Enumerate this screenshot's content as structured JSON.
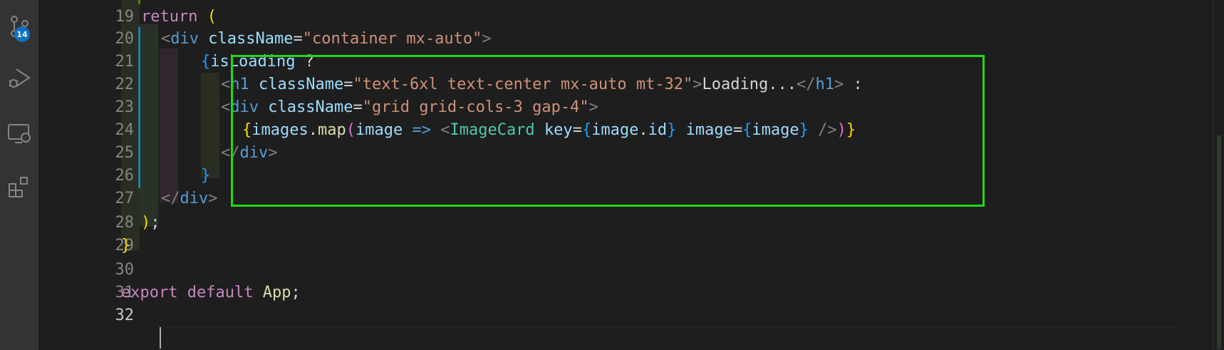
{
  "activity_bar": {
    "items": [
      {
        "icon": "source-control-icon",
        "badge": "14"
      },
      {
        "icon": "run-debug-icon"
      },
      {
        "icon": "remote-explorer-icon"
      },
      {
        "icon": "extensions-icon"
      }
    ]
  },
  "editor": {
    "language": "jsx",
    "lines": [
      {
        "number": "19"
      },
      {
        "number": "20"
      },
      {
        "number": "21"
      },
      {
        "number": "22"
      },
      {
        "number": "23"
      },
      {
        "number": "24"
      },
      {
        "number": "25"
      },
      {
        "number": "26"
      },
      {
        "number": "27"
      },
      {
        "number": "28"
      },
      {
        "number": "29"
      },
      {
        "number": "30"
      },
      {
        "number": "31"
      },
      {
        "number": "32"
      }
    ],
    "tokens": {
      "l19": [
        "return",
        "("
      ],
      "l20": [
        "<",
        "div",
        "className",
        "=",
        "\"container mx-auto\"",
        ">"
      ],
      "l21": [
        "{",
        "isLoading",
        "?"
      ],
      "l22": [
        "<",
        "h1",
        "className",
        "=",
        "\"text-6xl text-center mx-auto mt-32\"",
        ">",
        "Loading...",
        "</",
        "h1",
        ">",
        ":"
      ],
      "l23": [
        "<",
        "div",
        "className",
        "=",
        "\"grid grid-cols-3 gap-4\"",
        ">"
      ],
      "l24": [
        "{",
        "images",
        ".",
        "map",
        "(",
        "image",
        "=>",
        "<",
        "ImageCard",
        "key",
        "=",
        "{",
        "image",
        ".",
        "id",
        "}",
        "image",
        "=",
        "{",
        "image",
        "}",
        "/>",
        ")",
        "}"
      ],
      "l25": [
        "</",
        "div",
        ">"
      ],
      "l26": [
        "}"
      ],
      "l27": [
        "</",
        "div",
        ">"
      ],
      "l28": [
        ")",
        ";"
      ],
      "l29": [
        "}"
      ],
      "l31": [
        "export",
        "default",
        "App",
        ";"
      ]
    },
    "active_line": "32"
  },
  "colors": {
    "background": "#1e1e1e",
    "highlight_box": "#1ed81e",
    "badge": "#0e70c0"
  }
}
